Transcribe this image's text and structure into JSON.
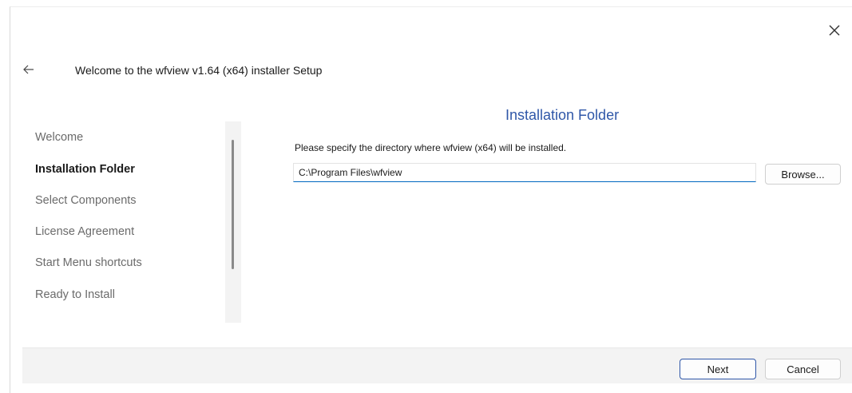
{
  "window": {
    "title": "Welcome to the wfview v1.64 (x64) installer Setup",
    "back_icon": "back-arrow-icon",
    "close_icon": "close-icon"
  },
  "sidebar": {
    "items": [
      {
        "label": "Welcome",
        "active": false
      },
      {
        "label": "Installation Folder",
        "active": true
      },
      {
        "label": "Select Components",
        "active": false
      },
      {
        "label": "License Agreement",
        "active": false
      },
      {
        "label": "Start Menu shortcuts",
        "active": false
      },
      {
        "label": "Ready to Install",
        "active": false
      }
    ]
  },
  "main": {
    "section_title": "Installation Folder",
    "instructions": "Please specify the directory where wfview (x64) will be installed.",
    "path_value": "C:\\Program Files\\wfview",
    "browse_label": "Browse..."
  },
  "footer": {
    "next_label": "Next",
    "cancel_label": "Cancel"
  },
  "colors": {
    "accent": "#2f57a8",
    "input_focus": "#0067c0",
    "footer_bg": "#f3f3f3"
  }
}
